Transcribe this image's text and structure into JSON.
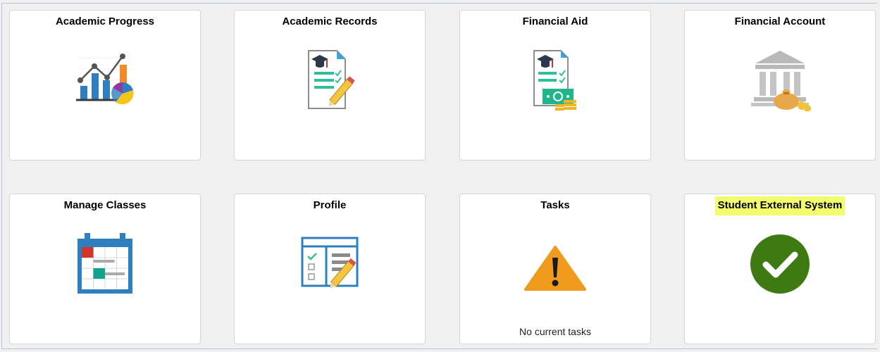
{
  "tiles": [
    {
      "title": "Academic Progress",
      "icon": "chart-icon"
    },
    {
      "title": "Academic Records",
      "icon": "certificate-icon"
    },
    {
      "title": "Financial Aid",
      "icon": "money-certificate-icon"
    },
    {
      "title": "Financial Account",
      "icon": "bank-icon"
    },
    {
      "title": "Manage Classes",
      "icon": "calendar-icon"
    },
    {
      "title": "Profile",
      "icon": "profile-form-icon"
    },
    {
      "title": "Tasks",
      "icon": "warning-icon",
      "footer": "No current tasks"
    },
    {
      "title": "Student External System",
      "icon": "checkmark-icon",
      "highlighted": true
    }
  ],
  "colors": {
    "highlight": "#f2fc6c",
    "check_green": "#3d7a11",
    "warning_orange": "#f09a1e",
    "calendar_blue": "#2f7fc0"
  }
}
